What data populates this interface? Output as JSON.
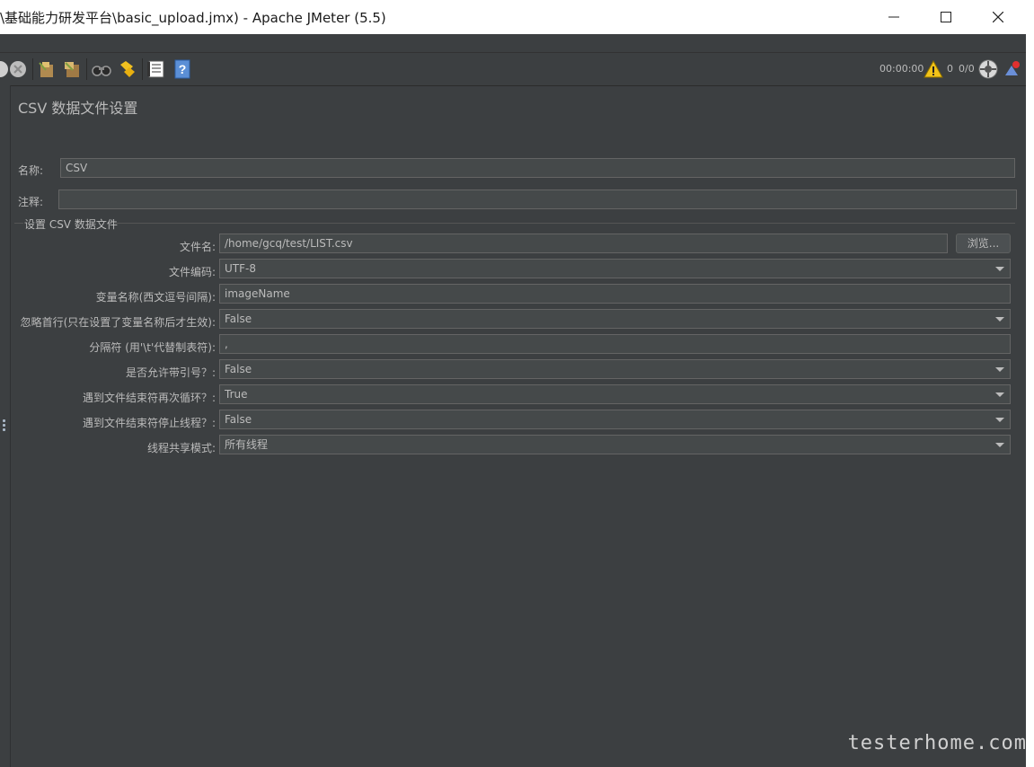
{
  "window": {
    "title": "\\基础能力研发平台\\basic_upload.jmx) - Apache JMeter (5.5)"
  },
  "toolbar": {
    "icons": [
      "stop-icon",
      "shutdown-icon",
      "clear-icon",
      "clear-all-icon",
      "search-icon",
      "reset-search-icon",
      "function-helper-icon",
      "help-icon"
    ],
    "elapsed_time": "00:00:00",
    "warning_count": "0",
    "threads": "0/0"
  },
  "panel": {
    "heading": "CSV 数据文件设置",
    "name_label": "名称:",
    "name_value": "CSV",
    "comment_label": "注释:",
    "comment_value": "",
    "group_title": "设置 CSV 数据文件",
    "browse_label": "浏览...",
    "rows": [
      {
        "label": "文件名:",
        "value": "/home/gcq/test/LIST.csv",
        "kind": "text"
      },
      {
        "label": "文件编码:",
        "value": "UTF-8",
        "kind": "combo"
      },
      {
        "label": "变量名称(西文逗号间隔):",
        "value": "imageName",
        "kind": "text"
      },
      {
        "label": "忽略首行(只在设置了变量名称后才生效):",
        "value": "False",
        "kind": "combo"
      },
      {
        "label": "分隔符 (用'\\t'代替制表符):",
        "value": ",",
        "kind": "text"
      },
      {
        "label": "是否允许带引号？:",
        "value": "False",
        "kind": "combo"
      },
      {
        "label": "遇到文件结束符再次循环？:",
        "value": "True",
        "kind": "combo"
      },
      {
        "label": "遇到文件结束符停止线程？:",
        "value": "False",
        "kind": "combo"
      },
      {
        "label": "线程共享模式:",
        "value": "所有线程",
        "kind": "combo"
      }
    ]
  },
  "watermark": "testerhome.com"
}
